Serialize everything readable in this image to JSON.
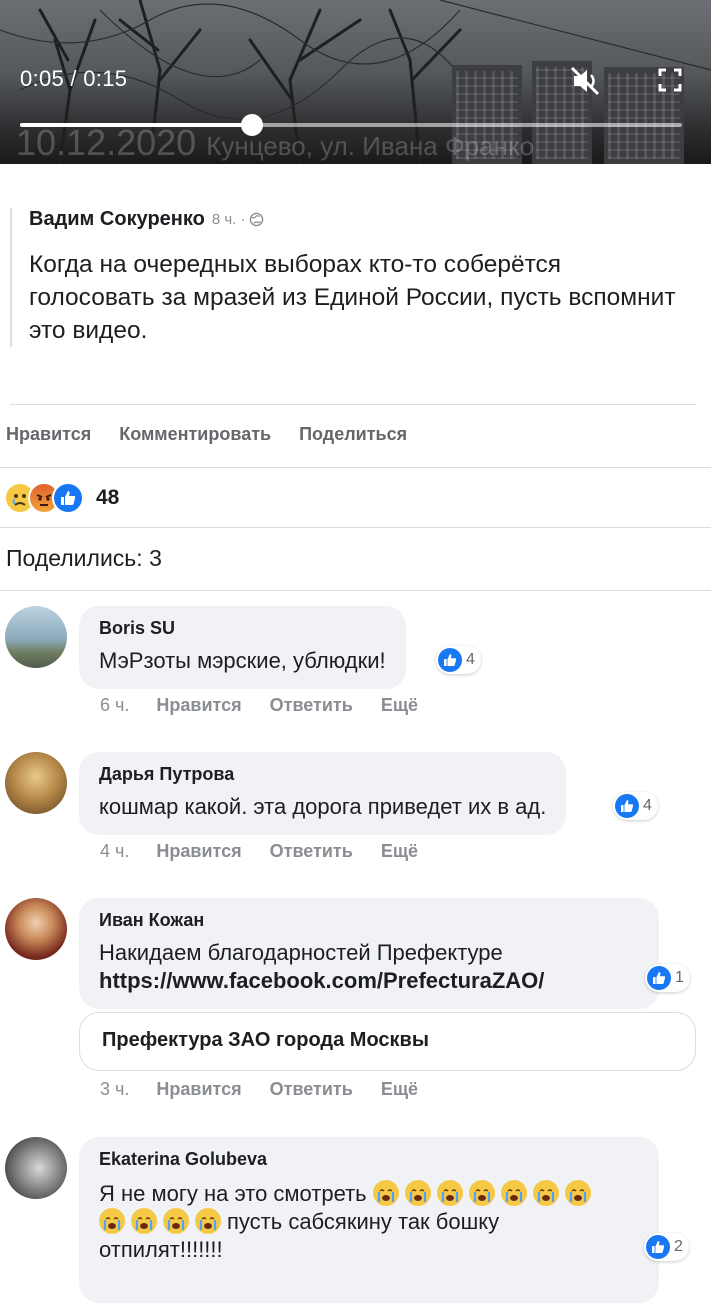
{
  "video": {
    "time": "0:05 / 0:15",
    "progress_fraction": 0.35,
    "watermark_date": "10.12.2020",
    "watermark_place": "Кунцево, ул. Ивана Франко"
  },
  "post": {
    "author": "Вадим Сокуренко",
    "time": "8 ч. ·",
    "text": "Когда на очередных выборах кто-то соберётся голосовать за мразей из Единой России, пусть вспомнит это видео."
  },
  "actions": {
    "like": "Нравится",
    "comment": "Комментировать",
    "share": "Поделиться"
  },
  "reactions": {
    "count": "48"
  },
  "shares_label": "Поделились: 3",
  "comments": [
    {
      "name": "Boris SU",
      "text": "МэРзоты мэрские, ублюдки!",
      "likes": "4",
      "time": "6 ч.",
      "like": "Нравится",
      "reply": "Ответить",
      "more": "Ещё"
    },
    {
      "name": "Дарья Путрова",
      "text": "кошмар какой. эта дорога приведет их в ад.",
      "likes": "4",
      "time": "4 ч.",
      "like": "Нравится",
      "reply": "Ответить",
      "more": "Ещё"
    },
    {
      "name": "Иван Кожан",
      "text": "Накидаем благодарностей Префектуре",
      "link": "https://www.facebook.com/PrefecturaZAO/",
      "likes": "1",
      "card_title": "Префектура ЗАО города Москвы",
      "time": "3 ч.",
      "like": "Нравится",
      "reply": "Ответить",
      "more": "Ещё"
    },
    {
      "name": "Ekaterina Golubeva",
      "text_line1": "Я не могу на это смотреть",
      "text_line2": "пусть сабсякину так бошку",
      "text_line3": "отпилят!!!!!!!",
      "likes": "2"
    }
  ],
  "icons": {
    "mute": "mute-icon",
    "fullscreen": "fullscreen-icon",
    "globe": "globe-icon",
    "like_reaction": "like-reaction-icon",
    "sad_reaction": "sad-reaction-icon",
    "angry_reaction": "angry-reaction-icon",
    "crying_emoji": "crying-emoji"
  },
  "colors": {
    "accent": "#1877f2",
    "bubble": "#f0f2f5",
    "muted": "#65676b"
  }
}
